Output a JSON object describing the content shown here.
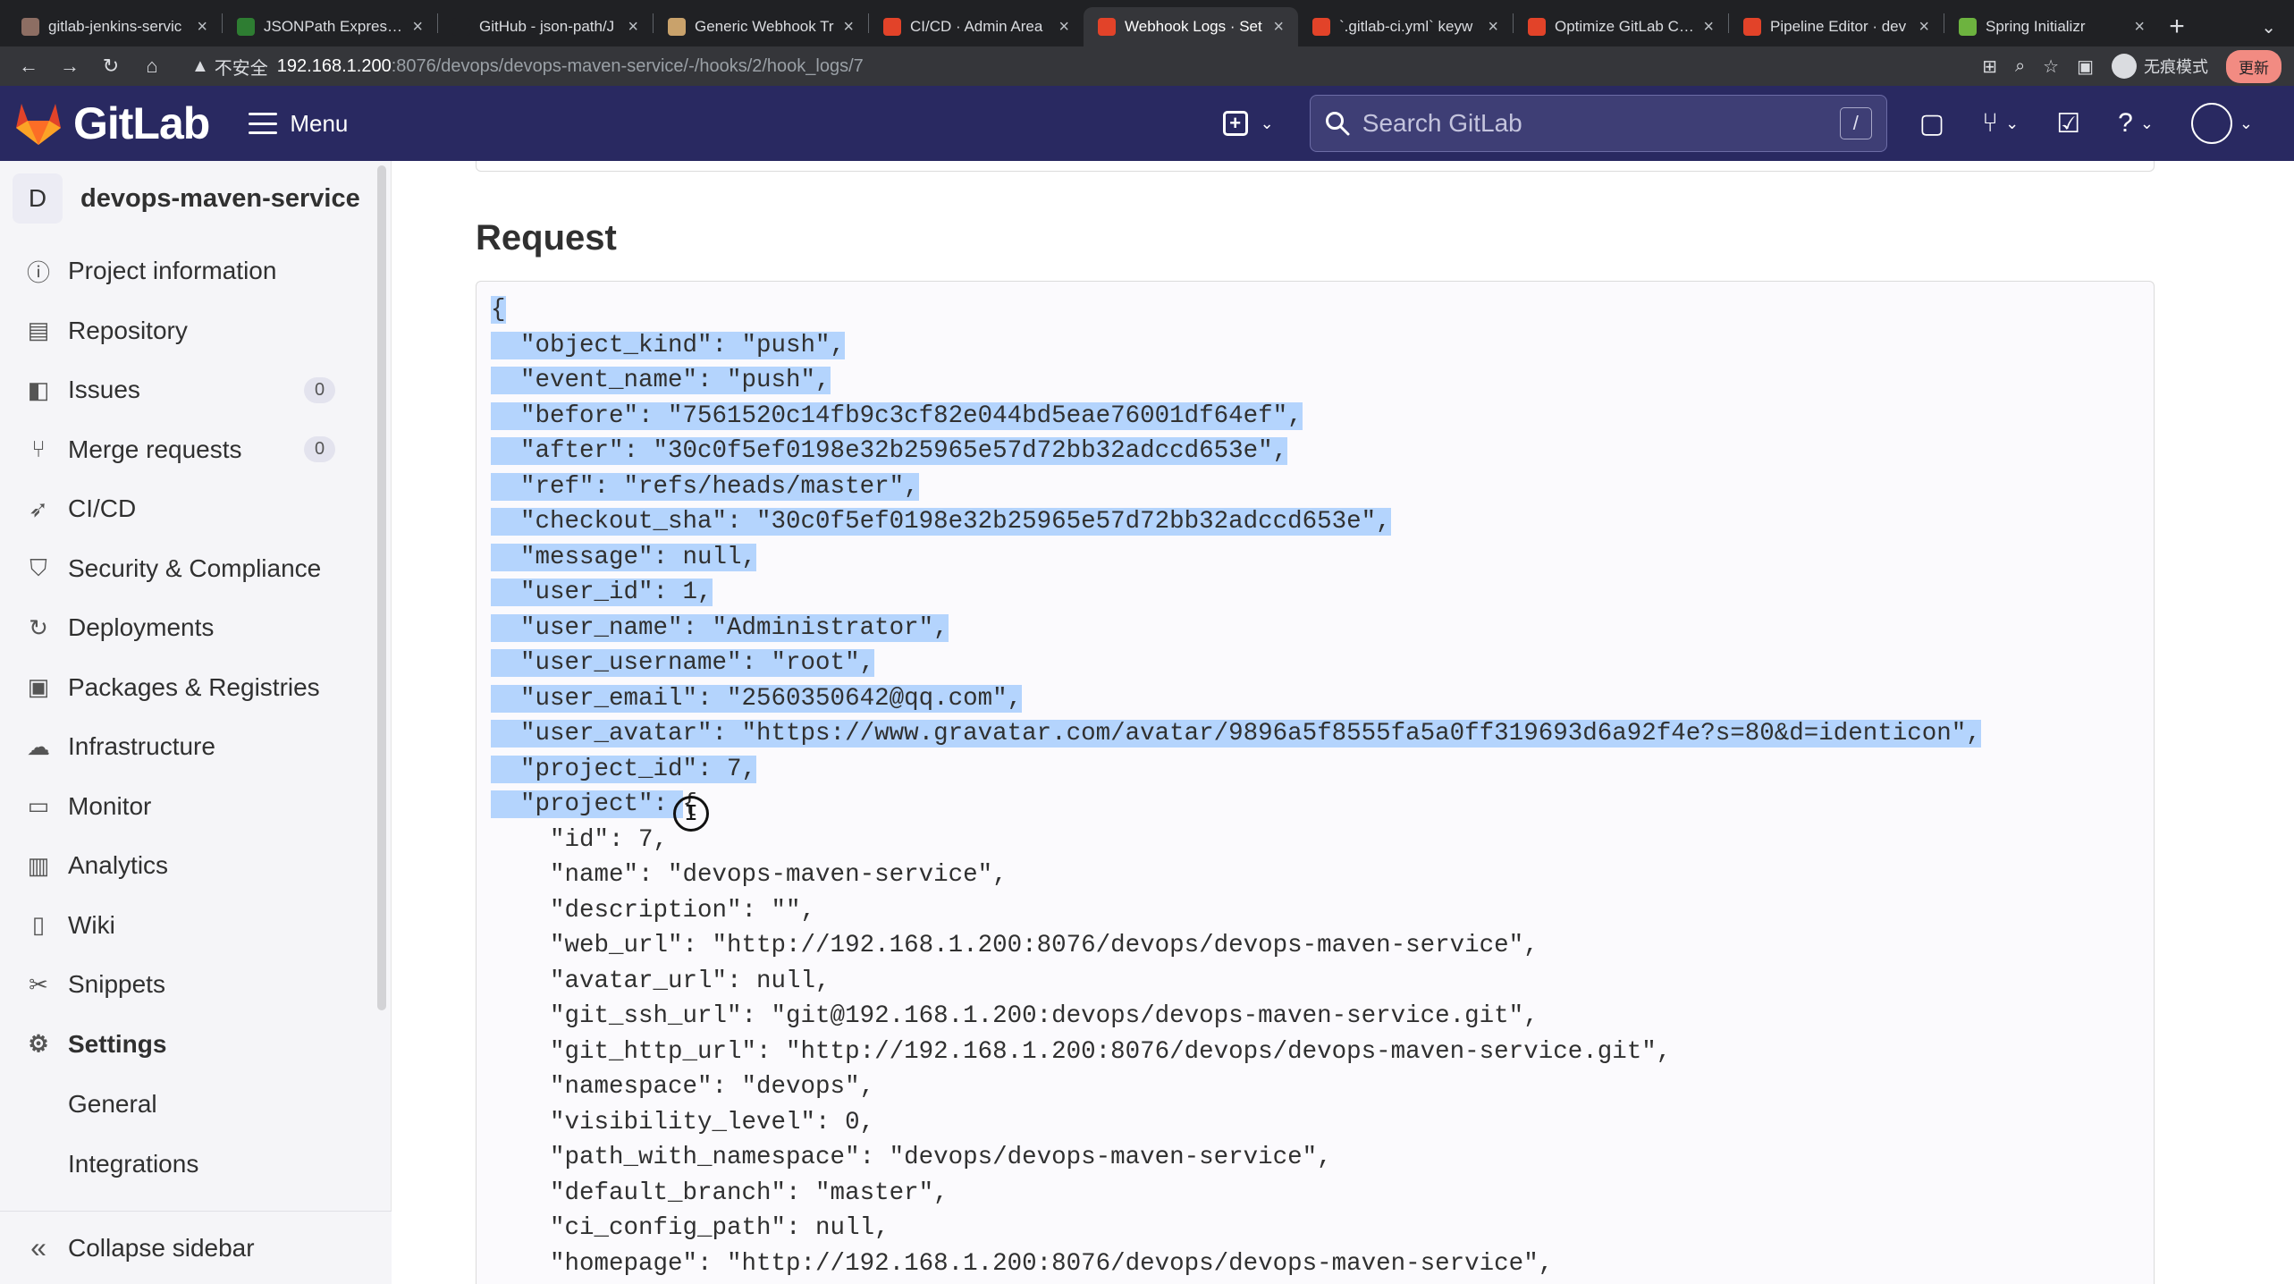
{
  "browser": {
    "tabs": [
      {
        "title": "gitlab-jenkins-servic",
        "favicon_color": "#8d6e63",
        "active": false
      },
      {
        "title": "JSONPath Expressio",
        "favicon_color": "#2e7d32",
        "active": false
      },
      {
        "title": "GitHub - json-path/J",
        "favicon_color": "#202124",
        "active": false
      },
      {
        "title": "Generic Webhook Tr",
        "favicon_color": "#c9a26b",
        "active": false
      },
      {
        "title": "CI/CD · Admin Area",
        "favicon_color": "#e24329",
        "active": false
      },
      {
        "title": "Webhook Logs · Set",
        "favicon_color": "#e24329",
        "active": true
      },
      {
        "title": "`.gitlab-ci.yml` keyw",
        "favicon_color": "#e24329",
        "active": false
      },
      {
        "title": "Optimize GitLab CI/C",
        "favicon_color": "#e24329",
        "active": false
      },
      {
        "title": "Pipeline Editor · dev",
        "favicon_color": "#e24329",
        "active": false
      },
      {
        "title": "Spring Initializr",
        "favicon_color": "#6db33f",
        "active": false
      }
    ],
    "new_tab_label": "+",
    "address": {
      "insecure_label": "不安全",
      "host": "192.168.1.200",
      "path": ":8076/devops/devops-maven-service/-/hooks/2/hook_logs/7"
    },
    "incognito_label": "无痕模式",
    "update_label": "更新"
  },
  "header": {
    "logo_text": "GitLab",
    "menu_label": "Menu",
    "search_placeholder": "Search GitLab",
    "search_shortcut": "/"
  },
  "sidebar": {
    "project_initial": "D",
    "project_name": "devops-maven-service",
    "items": [
      {
        "label": "Project information",
        "icon": "info-icon"
      },
      {
        "label": "Repository",
        "icon": "document-icon"
      },
      {
        "label": "Issues",
        "icon": "issues-icon",
        "badge": "0"
      },
      {
        "label": "Merge requests",
        "icon": "merge-request-icon",
        "badge": "0"
      },
      {
        "label": "CI/CD",
        "icon": "rocket-icon"
      },
      {
        "label": "Security & Compliance",
        "icon": "shield-icon"
      },
      {
        "label": "Deployments",
        "icon": "deployments-icon"
      },
      {
        "label": "Packages & Registries",
        "icon": "package-icon"
      },
      {
        "label": "Infrastructure",
        "icon": "cloud-gear-icon"
      },
      {
        "label": "Monitor",
        "icon": "monitor-icon"
      },
      {
        "label": "Analytics",
        "icon": "chart-icon"
      },
      {
        "label": "Wiki",
        "icon": "book-icon"
      },
      {
        "label": "Snippets",
        "icon": "scissors-icon"
      },
      {
        "label": "Settings",
        "icon": "gear-icon"
      }
    ],
    "settings_subitems": [
      "General",
      "Integrations"
    ],
    "collapse_label": "Collapse sidebar"
  },
  "main": {
    "section_title": "Request",
    "code_lines": [
      {
        "text": "{",
        "selected": true
      },
      {
        "text": "  \"object_kind\": \"push\",",
        "selected": true
      },
      {
        "text": "  \"event_name\": \"push\",",
        "selected": true
      },
      {
        "text": "  \"before\": \"7561520c14fb9c3cf82e044bd5eae76001df64ef\",",
        "selected": true
      },
      {
        "text": "  \"after\": \"30c0f5ef0198e32b25965e57d72bb32adccd653e\",",
        "selected": true
      },
      {
        "text": "  \"ref\": \"refs/heads/master\",",
        "selected": true
      },
      {
        "text": "  \"checkout_sha\": \"30c0f5ef0198e32b25965e57d72bb32adccd653e\",",
        "selected": true
      },
      {
        "text": "  \"message\": null,",
        "selected": true
      },
      {
        "text": "  \"user_id\": 1,",
        "selected": true
      },
      {
        "text": "  \"user_name\": \"Administrator\",",
        "selected": true
      },
      {
        "text": "  \"user_username\": \"root\",",
        "selected": true
      },
      {
        "text": "  \"user_email\": \"2560350642@qq.com\",",
        "selected": true
      },
      {
        "text": "  \"user_avatar\": \"https://www.gravatar.com/avatar/9896a5f8555fa5a0ff319693d6a92f4e?s=80&d=identicon\",",
        "selected": true
      },
      {
        "text": "  \"project_id\": 7,",
        "selected": true
      },
      {
        "text": "  \"project\": ",
        "selected": true,
        "tail": "{"
      },
      {
        "text": "    \"id\": 7,",
        "selected": false
      },
      {
        "text": "    \"name\": \"devops-maven-service\",",
        "selected": false
      },
      {
        "text": "    \"description\": \"\",",
        "selected": false
      },
      {
        "text": "    \"web_url\": \"http://192.168.1.200:8076/devops/devops-maven-service\",",
        "selected": false
      },
      {
        "text": "    \"avatar_url\": null,",
        "selected": false
      },
      {
        "text": "    \"git_ssh_url\": \"git@192.168.1.200:devops/devops-maven-service.git\",",
        "selected": false
      },
      {
        "text": "    \"git_http_url\": \"http://192.168.1.200:8076/devops/devops-maven-service.git\",",
        "selected": false
      },
      {
        "text": "    \"namespace\": \"devops\",",
        "selected": false
      },
      {
        "text": "    \"visibility_level\": 0,",
        "selected": false
      },
      {
        "text": "    \"path_with_namespace\": \"devops/devops-maven-service\",",
        "selected": false
      },
      {
        "text": "    \"default_branch\": \"master\",",
        "selected": false
      },
      {
        "text": "    \"ci_config_path\": null,",
        "selected": false
      },
      {
        "text": "    \"homepage\": \"http://192.168.1.200:8076/devops/devops-maven-service\",",
        "selected": false
      }
    ]
  },
  "colors": {
    "header_bg": "#292961",
    "selection": "#b4d4fd",
    "sidebar_bg": "#f5f5f8"
  }
}
